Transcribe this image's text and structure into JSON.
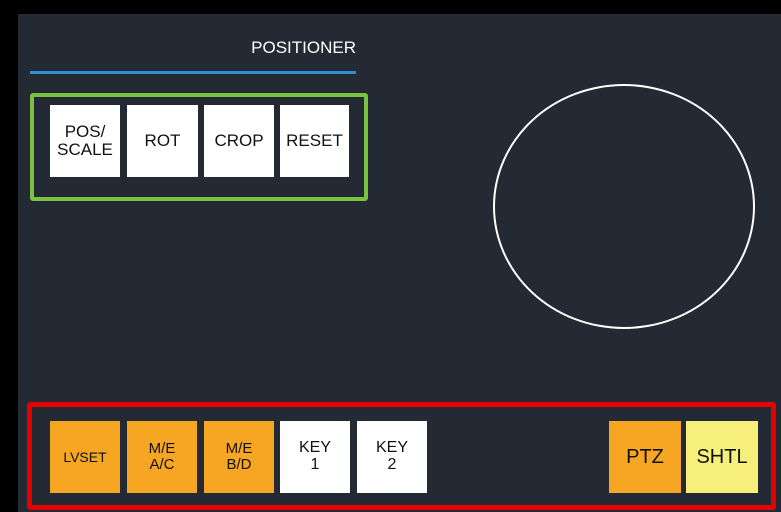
{
  "positioner": {
    "title": "POSITIONER",
    "buttons": [
      {
        "label": "POS/\nSCALE"
      },
      {
        "label": "ROT"
      },
      {
        "label": "CROP"
      },
      {
        "label": "RESET"
      }
    ]
  },
  "bottom": {
    "buttons": [
      {
        "label": "LVSET"
      },
      {
        "label": "M/E\nA/C"
      },
      {
        "label": "M/E\nB/D"
      },
      {
        "label": "KEY\n1"
      },
      {
        "label": "KEY\n2"
      },
      {
        "label": "PTZ"
      },
      {
        "label": "SHTL"
      }
    ]
  },
  "colors": {
    "background": "#232a33",
    "accent_line": "#2d8fd6",
    "green_frame": "#7cc242",
    "red_frame": "#e60000",
    "orange": "#f6a623",
    "yellow": "#f6f07a"
  }
}
